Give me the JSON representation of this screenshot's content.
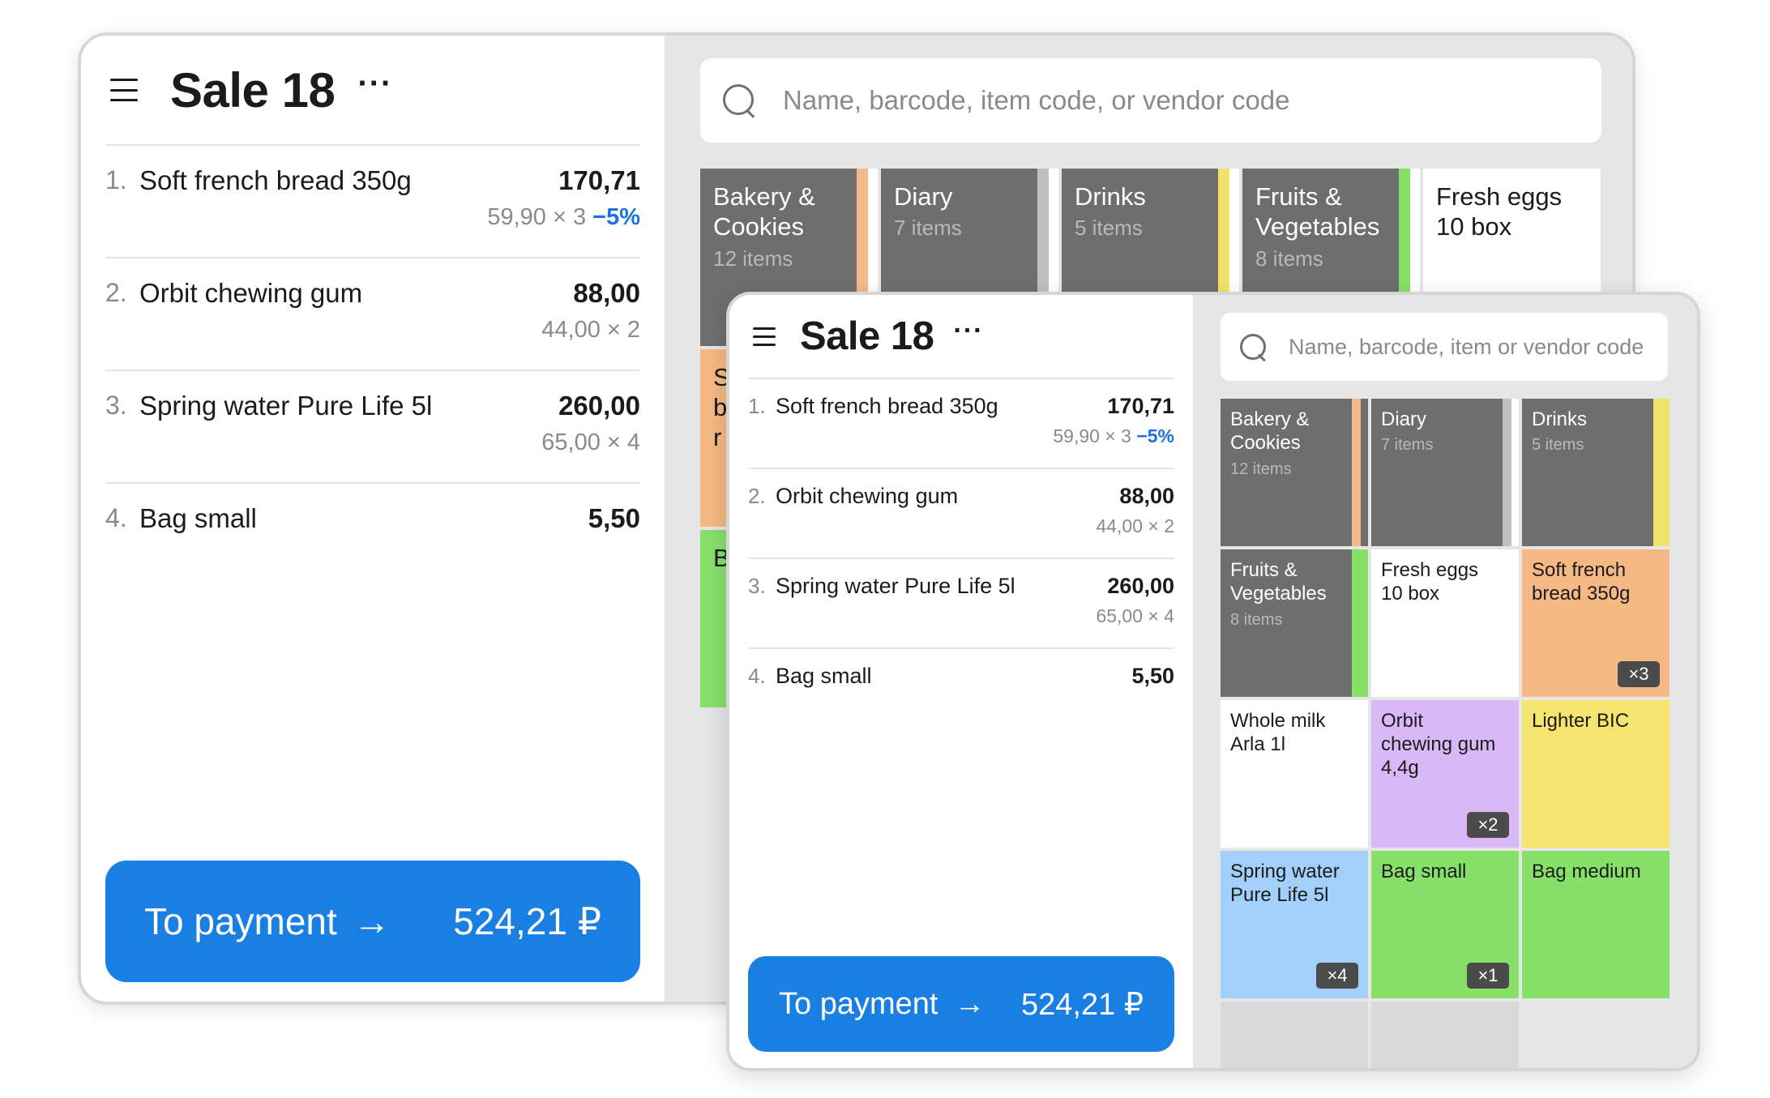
{
  "sale": {
    "title": "Sale 18",
    "menu_dots": "···",
    "items": [
      {
        "num": "1.",
        "name": "Soft french bread 350g",
        "amount": "170,71",
        "detail": "59,90 × 3",
        "discount": "−5%"
      },
      {
        "num": "2.",
        "name": "Orbit chewing gum",
        "amount": "88,00",
        "detail": "44,00 × 2",
        "discount": ""
      },
      {
        "num": "3.",
        "name": "Spring water Pure Life 5l",
        "amount": "260,00",
        "detail": "65,00 × 4",
        "discount": ""
      },
      {
        "num": "4.",
        "name": "Bag small",
        "amount": "5,50",
        "detail": "",
        "discount": ""
      }
    ],
    "pay_label": "To payment",
    "pay_arrow": "→",
    "pay_total": "524,21 ₽"
  },
  "search": {
    "placeholder_large": "Name, barcode, item code, or vendor code",
    "placeholder_small": "Name, barcode, item or vendor code"
  },
  "catalog_large": [
    {
      "name": "Bakery & Cookies",
      "count": "12 items",
      "stripe": "#f5b98a"
    },
    {
      "name": "Diary",
      "count": "7 items",
      "stripe": "#c0c0c0"
    },
    {
      "name": "Drinks",
      "count": "5 items",
      "stripe": "#f2e46a"
    },
    {
      "name": "Fruits & Vegetables",
      "count": "8 items",
      "stripe": "#86e06a"
    },
    {
      "name": "Fresh eggs 10 box"
    },
    {
      "name": "S br"
    },
    {
      "name": "B"
    }
  ],
  "catalog_small": [
    {
      "name": "Bakery & Cookies",
      "count": "12 items",
      "stripe": "#f5b98a"
    },
    {
      "name": "Diary",
      "count": "7 items",
      "stripe": "#c0c0c0"
    },
    {
      "name": "Drinks",
      "count": "5 items",
      "stripe": "#f2e46a"
    },
    {
      "name": "Fruits & Vegetables",
      "count": "8 items",
      "stripe": "#86e06a"
    },
    {
      "name": "Fresh eggs 10 box",
      "color": "#ffffff"
    },
    {
      "name": "Soft french bread 350g",
      "color": "#f6b884",
      "badge": "×3"
    },
    {
      "name": "Whole milk Arla 1l",
      "color": "#ffffff"
    },
    {
      "name": "Orbit chewing gum 4,4g",
      "color": "#d9b8f7",
      "badge": "×2"
    },
    {
      "name": "Lighter BIC",
      "color": "#f5e56f"
    },
    {
      "name": "Spring water Pure Life 5l",
      "color": "#a3d0fa",
      "badge": "×4"
    },
    {
      "name": "Bag small",
      "color": "#86e06a",
      "badge": "×1"
    },
    {
      "name": "Bag medium",
      "color": "#86e06a"
    }
  ],
  "colors": {
    "accent": "#1a7fe3",
    "discount": "#1873e0",
    "folder": "#6e6e6e",
    "catalog_bg": "#e6e6e6"
  }
}
